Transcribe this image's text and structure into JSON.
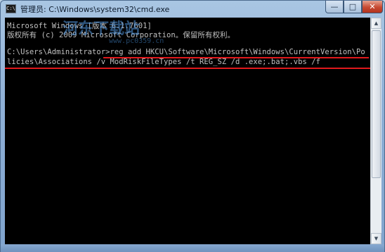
{
  "window": {
    "title": "管理员: C:\\Windows\\system32\\cmd.exe",
    "icon_text": "C:\\",
    "minimize_glyph": "—",
    "maximize_glyph": "□",
    "close_glyph": "✕"
  },
  "console": {
    "lines": [
      "Microsoft Windows [版本 6.1.7601]",
      "版权所有 (c) 2009 Microsoft Corporation。保留所有权利。",
      "C:\\Users\\Administrator>reg add HKCU\\Software\\Microsoft\\Windows\\CurrentVersion\\Po",
      "licies\\Associations /v ModRiskFileTypes /t REG_SZ /d .exe;.bat;.vbs /f"
    ],
    "text_color": "#c0c0c0",
    "background": "#000000",
    "highlight_color": "#e0191c"
  },
  "watermark": {
    "text": "河东下载站",
    "url": "www.pc0359.cn"
  },
  "scrollbar": {
    "up_glyph": "▲",
    "down_glyph": "▼"
  }
}
